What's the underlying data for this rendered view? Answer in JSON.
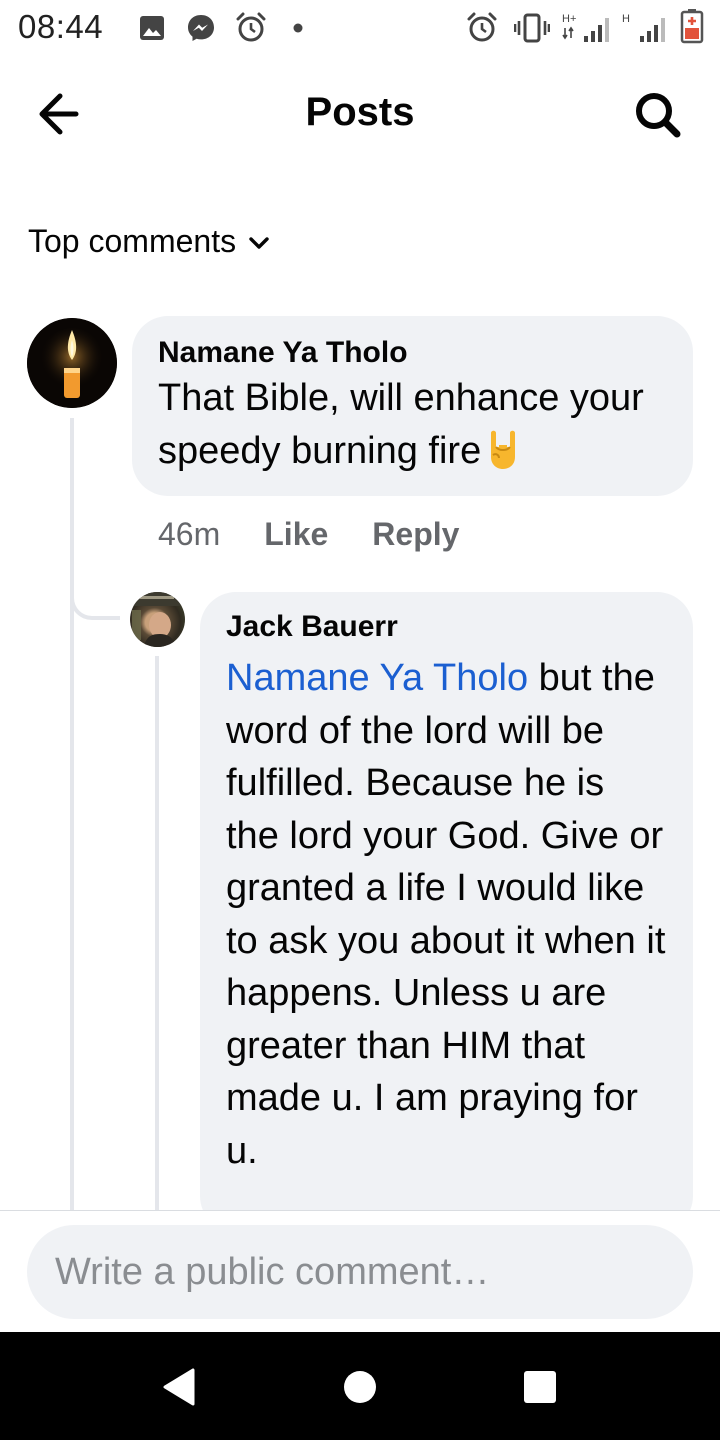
{
  "status_bar": {
    "time": "08:44",
    "left_icons": [
      "image-icon",
      "messenger-icon",
      "alarm-icon",
      "dot-icon"
    ],
    "right_icons": [
      "alarm-icon",
      "vibrate-icon",
      "signal-hplus-icon",
      "signal-h-icon",
      "battery-icon"
    ]
  },
  "header": {
    "title": "Posts",
    "back_icon": "arrow-left-icon",
    "search_icon": "search-icon"
  },
  "filter": {
    "label": "Top comments",
    "icon": "chevron-down-icon"
  },
  "comments": [
    {
      "author": "Namane Ya Tholo",
      "text": "That Bible, will enhance your speedy burning fire",
      "emoji": "sign-of-the-horns-emoji",
      "avatar": "candle-avatar",
      "time": "46m",
      "like_label": "Like",
      "reply_label": "Reply"
    }
  ],
  "replies": [
    {
      "author": "Jack Bauerr",
      "mention": "Namane Ya Tholo",
      "text": " but the word of the lord will be fulfilled. Because he is the lord your God. Give or granted a life I would like to ask you about it when it happens. Unless u are greater than HIM that made u. I am praying for u."
    }
  ],
  "composer": {
    "placeholder": "Write a public comment…"
  },
  "nav_bar": {
    "icons": [
      "back-triangle-icon",
      "home-circle-icon",
      "recents-square-icon"
    ]
  },
  "colors": {
    "bubble": "#f0f2f5",
    "mention": "#1b5fd1",
    "secondary_text": "#65676b",
    "thread_line": "#e4e6eb"
  }
}
